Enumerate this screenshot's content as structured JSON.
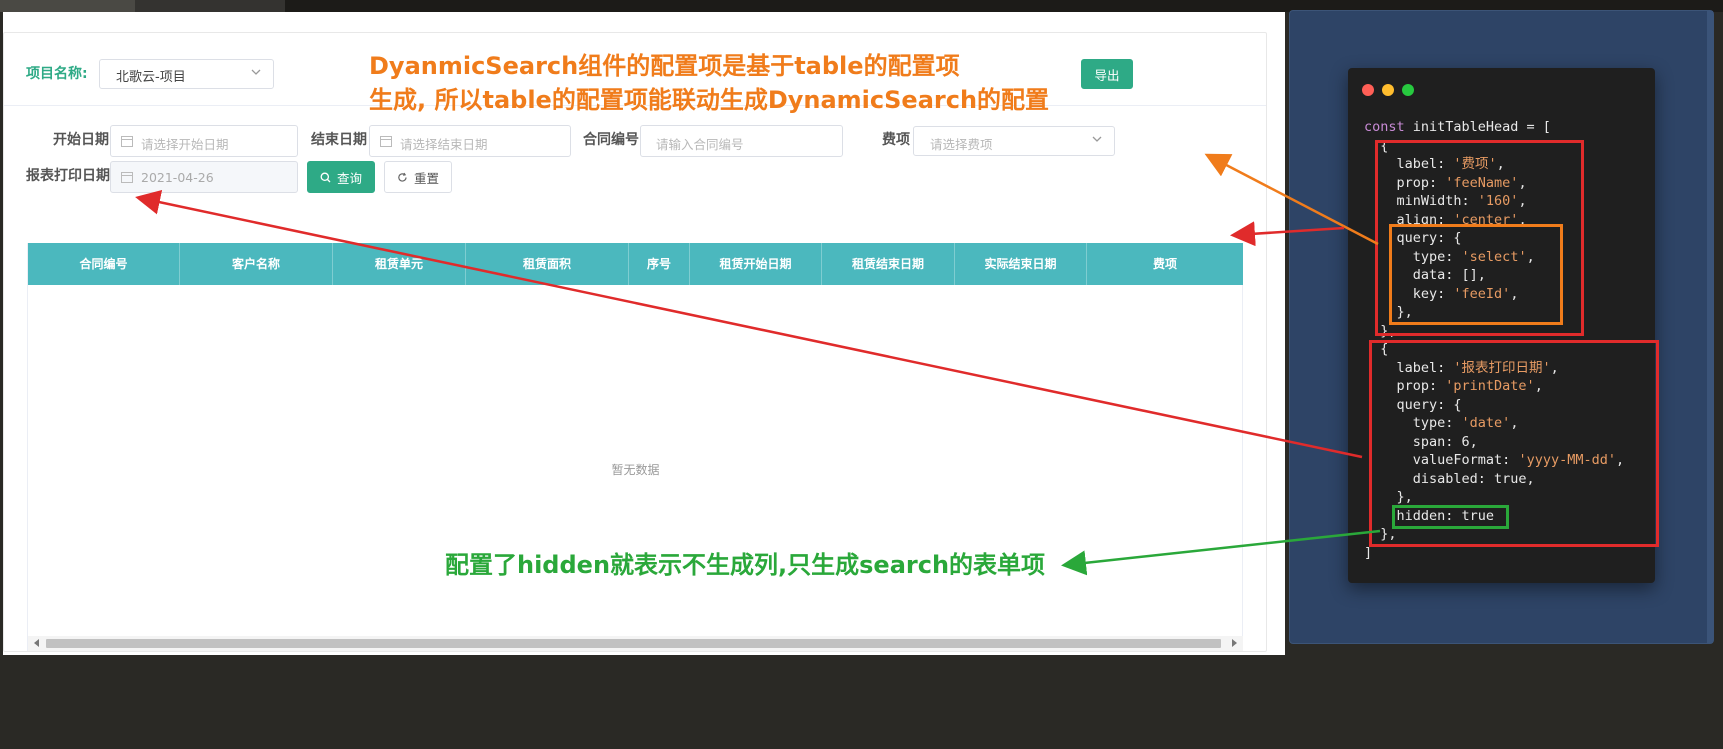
{
  "app": {
    "project_label": "项目名称:",
    "project_value": "北歌云-项目",
    "export_button": "导出"
  },
  "search": {
    "start_date_label": "开始日期",
    "start_date_placeholder": "请选择开始日期",
    "end_date_label": "结束日期",
    "end_date_placeholder": "请选择结束日期",
    "contract_no_label": "合同编号",
    "contract_no_placeholder": "请输入合同编号",
    "fee_label": "费项",
    "fee_placeholder": "请选择费项",
    "print_date_label": "报表打印日期",
    "print_date_value": "2021-04-26",
    "query_button": "查询",
    "reset_button": "重置"
  },
  "table": {
    "columns": [
      "合同编号",
      "客户名称",
      "租赁单元",
      "租赁面积",
      "序号",
      "租赁开始日期",
      "租赁结束日期",
      "实际结束日期",
      "费项"
    ],
    "empty_text": "暂无数据"
  },
  "annotations": {
    "orange_line1": "DyanmicSearch组件的配置项是基于table的配置项",
    "orange_line2": "生成, 所以table的配置项能联动生成DynamicSearch的配置",
    "green_note": "配置了hidden就表示不生成列,只生成search的表单项"
  },
  "code": {
    "lines": [
      {
        "k": "",
        "t": "const initTableHead = ["
      },
      {
        "k": "",
        "t": "  {"
      },
      {
        "k": "label",
        "t": "    label: '费项',"
      },
      {
        "k": "",
        "t": "    prop: 'feeName',"
      },
      {
        "k": "",
        "t": "    minWidth: '160',"
      },
      {
        "k": "",
        "t": "    align: 'center',"
      },
      {
        "k": "",
        "t": "    query: {"
      },
      {
        "k": "",
        "t": "      type: 'select',"
      },
      {
        "k": "",
        "t": "      data: [],"
      },
      {
        "k": "",
        "t": "      key: 'feeId',"
      },
      {
        "k": "",
        "t": "    },"
      },
      {
        "k": "",
        "t": "  },"
      },
      {
        "k": "",
        "t": "  {"
      },
      {
        "k": "",
        "t": "    label: '报表打印日期',"
      },
      {
        "k": "",
        "t": "    prop: 'printDate',"
      },
      {
        "k": "",
        "t": "    query: {"
      },
      {
        "k": "",
        "t": "      type: 'date',"
      },
      {
        "k": "",
        "t": "      span: 6,"
      },
      {
        "k": "",
        "t": "      valueFormat: 'yyyy-MM-dd',"
      },
      {
        "k": "",
        "t": "      disabled: true,"
      },
      {
        "k": "",
        "t": "    },"
      },
      {
        "k": "",
        "t": "    hidden: true"
      },
      {
        "k": "",
        "t": "  },"
      },
      {
        "k": "",
        "t": "]"
      }
    ]
  },
  "colors": {
    "accent": "#2eaa86",
    "table_header": "#4bb8be",
    "annotation_orange": "#f07c1b",
    "annotation_red": "#e02b2b",
    "annotation_green": "#2aa83a"
  }
}
